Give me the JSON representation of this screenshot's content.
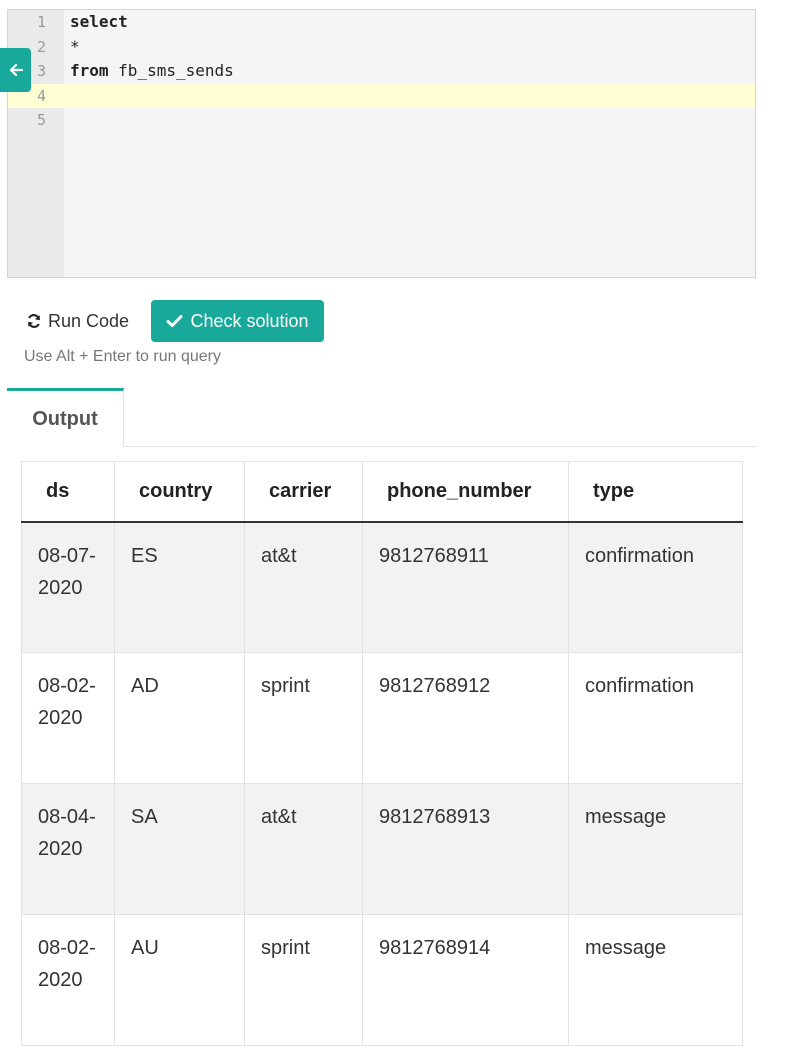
{
  "editor": {
    "lines": [
      {
        "num": "1",
        "keyword": "select",
        "rest": ""
      },
      {
        "num": "2",
        "keyword": "",
        "rest": "*"
      },
      {
        "num": "3",
        "keyword": "from",
        "rest": " fb_sms_sends"
      },
      {
        "num": "4",
        "keyword": "",
        "rest": ""
      },
      {
        "num": "5",
        "keyword": "",
        "rest": ""
      }
    ],
    "active_line": 4
  },
  "toolbar": {
    "run_label": "Run Code",
    "check_label": "Check solution",
    "hint": "Use Alt + Enter to run query"
  },
  "tabs": {
    "output_label": "Output"
  },
  "table": {
    "columns": [
      "ds",
      "country",
      "carrier",
      "phone_number",
      "type"
    ],
    "rows": [
      {
        "ds": "08-07-2020",
        "country": "ES",
        "carrier": "at&t",
        "phone_number": "9812768911",
        "type": "confirmation"
      },
      {
        "ds": "08-02-2020",
        "country": "AD",
        "carrier": "sprint",
        "phone_number": "9812768912",
        "type": "confirmation"
      },
      {
        "ds": "08-04-2020",
        "country": "SA",
        "carrier": "at&t",
        "phone_number": "9812768913",
        "type": "message"
      },
      {
        "ds": "08-02-2020",
        "country": "AU",
        "carrier": "sprint",
        "phone_number": "9812768914",
        "type": "message"
      }
    ]
  },
  "colors": {
    "accent": "#18a99a",
    "active_line": "#ffffd3"
  },
  "icons": {
    "back": "arrow-left-icon",
    "run": "refresh-icon",
    "check": "check-icon"
  }
}
